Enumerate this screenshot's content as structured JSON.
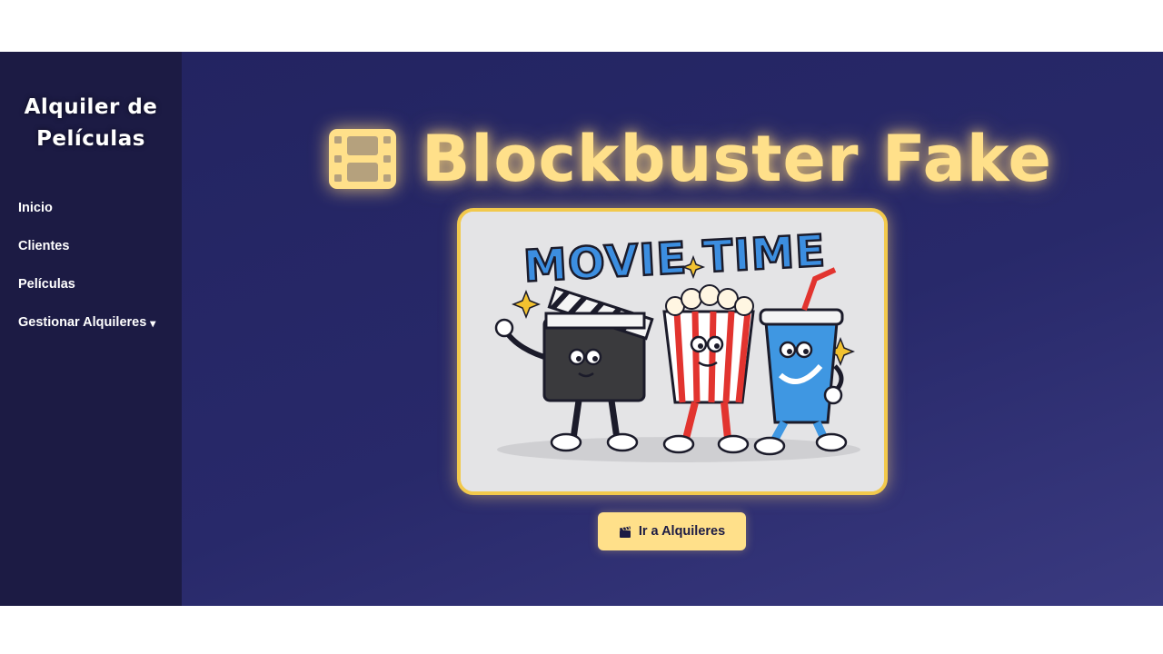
{
  "sidebar": {
    "brand_line1": "Alquiler de",
    "brand_line2": "Películas",
    "items": [
      {
        "label": "Inicio"
      },
      {
        "label": "Clientes"
      },
      {
        "label": "Películas"
      },
      {
        "label": "Gestionar Alquileres",
        "caret": "▾"
      }
    ]
  },
  "hero": {
    "title": "Blockbuster Fake",
    "title_icon": "film-icon",
    "image_text": "MOVIE TIME",
    "image_description_icon": "movie-time-illustration"
  },
  "cta": {
    "label": "Ir a Alquileres",
    "icon": "clapperboard-icon"
  },
  "colors": {
    "sidebar_bg": "#1c1b44",
    "main_bg": "#28296a",
    "accent": "#ffe08a",
    "card_border": "#f2c94c"
  }
}
